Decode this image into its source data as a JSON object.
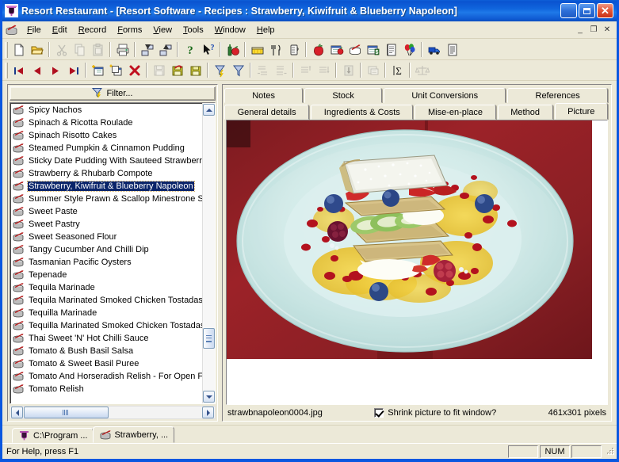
{
  "window": {
    "title": "Resort Restaurant - [Resort Software - Recipes : Strawberry, Kiwifruit & Blueberry Napoleon]",
    "title_icon": "restaurant-app-icon",
    "minimize_label": "_",
    "maximize_label": "",
    "close_label": "✕",
    "mdi_minimize_label": "_",
    "mdi_restore_label": "❐",
    "mdi_close_label": "✕"
  },
  "menu": {
    "doc_icon": "recipe-pot-icon",
    "items": [
      {
        "label": "File",
        "accel": "F"
      },
      {
        "label": "Edit",
        "accel": "E"
      },
      {
        "label": "Record",
        "accel": "R"
      },
      {
        "label": "Forms",
        "accel": "F"
      },
      {
        "label": "View",
        "accel": "V"
      },
      {
        "label": "Tools",
        "accel": "T"
      },
      {
        "label": "Window",
        "accel": "W"
      },
      {
        "label": "Help",
        "accel": "H"
      }
    ]
  },
  "toolbar_row1": [
    {
      "name": "new-icon",
      "enabled": true
    },
    {
      "name": "open-folder-icon",
      "enabled": true
    },
    {
      "sep": true
    },
    {
      "name": "cut-scissors-icon",
      "enabled": false
    },
    {
      "name": "copy-icon",
      "enabled": false
    },
    {
      "name": "paste-icon",
      "enabled": false
    },
    {
      "sep": true
    },
    {
      "name": "print-icon",
      "enabled": true
    },
    {
      "sep": true
    },
    {
      "name": "import-down-icon",
      "enabled": true
    },
    {
      "name": "export-up-icon",
      "enabled": true
    },
    {
      "sep": true
    },
    {
      "name": "help-question-icon",
      "enabled": true
    },
    {
      "name": "context-help-icon",
      "enabled": true
    },
    {
      "sep": true
    },
    {
      "name": "beverages-icon",
      "enabled": true
    },
    {
      "sep": true
    },
    {
      "name": "stock-box-icon",
      "enabled": true
    },
    {
      "name": "cutlery-icon",
      "enabled": true
    },
    {
      "name": "measure-jug-icon",
      "enabled": true
    },
    {
      "sep": true
    },
    {
      "name": "apple-ingredients-icon",
      "enabled": true
    },
    {
      "name": "ingredient-list-icon",
      "enabled": true
    },
    {
      "name": "recipes-pot-icon",
      "enabled": true
    },
    {
      "name": "costing-icon",
      "enabled": true
    },
    {
      "name": "menu-book-icon",
      "enabled": true
    },
    {
      "name": "functions-balloons-icon",
      "enabled": true
    },
    {
      "sep": true
    },
    {
      "name": "suppliers-truck-icon",
      "enabled": true
    },
    {
      "name": "reports-icon",
      "enabled": true
    }
  ],
  "toolbar_row2": [
    {
      "name": "first-record-icon",
      "enabled": true
    },
    {
      "name": "previous-record-icon",
      "enabled": true
    },
    {
      "name": "next-record-icon",
      "enabled": true
    },
    {
      "name": "last-record-icon",
      "enabled": true
    },
    {
      "sep": true
    },
    {
      "name": "new-record-icon",
      "enabled": true
    },
    {
      "name": "duplicate-record-icon",
      "enabled": true
    },
    {
      "name": "delete-record-icon",
      "enabled": true
    },
    {
      "sep": true
    },
    {
      "name": "save-icon",
      "enabled": false
    },
    {
      "name": "save-undo-icon",
      "enabled": true
    },
    {
      "name": "save-close-icon",
      "enabled": true
    },
    {
      "sep": true
    },
    {
      "name": "quick-filter-icon",
      "enabled": true
    },
    {
      "name": "filter-icon",
      "enabled": true
    },
    {
      "sep": true
    },
    {
      "name": "indent-left-icon",
      "enabled": false
    },
    {
      "name": "indent-right-icon",
      "enabled": false
    },
    {
      "sep": true
    },
    {
      "name": "move-up-icon",
      "enabled": false
    },
    {
      "name": "move-down-icon",
      "enabled": false
    },
    {
      "sep": true
    },
    {
      "name": "insert-row-icon",
      "enabled": false
    },
    {
      "sep": true
    },
    {
      "name": "copy-form-icon",
      "enabled": false
    },
    {
      "sep": true
    },
    {
      "name": "sum-icon",
      "enabled": true
    },
    {
      "sep": true
    },
    {
      "name": "balance-scales-icon",
      "enabled": false
    }
  ],
  "list_pane": {
    "filter_label": "Filter...",
    "filter_icon": "filter-funnel-icon",
    "item_icon": "recipe-pot-icon",
    "selected_index": 6,
    "items": [
      "Spicy Nachos",
      "Spinach & Ricotta Roulade",
      "Spinach Risotto Cakes",
      "Steamed Pumpkin & Cinnamon Pudding",
      "Sticky Date Pudding With Sauteed Strawberry",
      "Strawberry & Rhubarb Compote",
      "Strawberry, Kiwifruit & Blueberry Napoleon",
      "Summer Style Prawn & Scallop Minestrone Soup",
      "Sweet Paste",
      "Sweet Pastry",
      "Sweet Seasoned Flour",
      "Tangy Cucumber And Chilli Dip",
      "Tasmanian Pacific Oysters",
      "Tepenade",
      "Tequila Marinade",
      "Tequila Marinated Smoked Chicken Tostadas",
      "Tequilla Marinade",
      "Tequilla Marinated Smoked Chicken Tostadas",
      "Thai Sweet 'N' Hot Chilli Sauce",
      "Tomato & Bush Basil Salsa",
      "Tomato & Sweet Basil Puree",
      "Tomato And Horseradish Relish - For Open Fa",
      "Tomato Relish"
    ]
  },
  "detail_pane": {
    "tabs_row1": [
      {
        "label": "Notes",
        "active": false
      },
      {
        "label": "Stock",
        "active": false
      },
      {
        "label": "Unit Conversions",
        "active": false
      },
      {
        "label": "References",
        "active": false
      }
    ],
    "tabs_row2": [
      {
        "label": "General details",
        "active": false
      },
      {
        "label": "Ingredients & Costs",
        "active": false
      },
      {
        "label": "Mise-en-place",
        "active": false
      },
      {
        "label": "Method",
        "active": false
      },
      {
        "label": "Picture",
        "active": true
      }
    ],
    "picture": {
      "alt": "Strawberry kiwifruit and blueberry napoleon dessert on a pale blue plate with red tablecloth",
      "filename": "strawbnapoleon0004.jpg",
      "shrink_label": "Shrink picture to fit window?",
      "shrink_checked": true,
      "dimensions": "461x301 pixels"
    }
  },
  "mdi_tabbar": [
    {
      "label": "C:\\Program ...",
      "icon": "restaurant-app-icon",
      "active": false
    },
    {
      "label": "Strawberry, ...",
      "icon": "recipe-pot-icon",
      "active": true
    }
  ],
  "statusbar": {
    "message": "For Help, press F1",
    "cell_1": "",
    "cell_2": "NUM",
    "cell_3": ""
  },
  "colors": {
    "titlebar_blue": "#0f5fd8",
    "window_face": "#ece9d8",
    "selection_blue": "#0a246a",
    "frame_blue": "#0a57e0",
    "photo_tablecloth": "#8e2226",
    "photo_plate": "#cfe9e8"
  }
}
